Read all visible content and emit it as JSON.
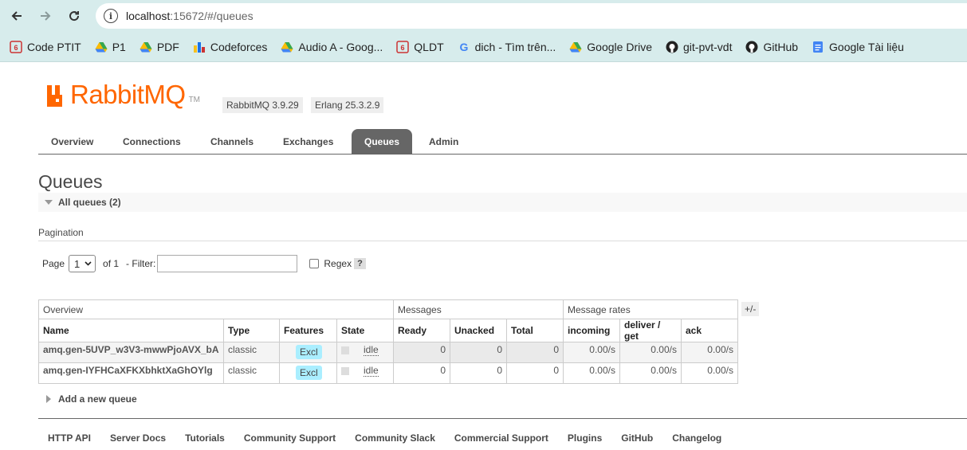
{
  "browser": {
    "url_host": "localhost",
    "url_rest": ":15672/#/queues",
    "bookmarks": [
      {
        "label": "Code PTIT",
        "icon": "ptit-icon",
        "color": "#c33"
      },
      {
        "label": "P1",
        "icon": "drive-icon",
        "color": "#1a73e8"
      },
      {
        "label": "PDF",
        "icon": "drive-icon",
        "color": "#1a73e8"
      },
      {
        "label": "Codeforces",
        "icon": "codeforces-icon",
        "color": "#1a73e8"
      },
      {
        "label": "Audio A - Goog...",
        "icon": "drive-icon",
        "color": "#1a73e8"
      },
      {
        "label": "QLDT",
        "icon": "ptit-icon",
        "color": "#c33"
      },
      {
        "label": "dich - Tìm trên...",
        "icon": "google-icon",
        "color": "#4285f4"
      },
      {
        "label": "Google Drive",
        "icon": "drive-icon",
        "color": "#1a73e8"
      },
      {
        "label": "git-pvt-vdt",
        "icon": "github-icon",
        "color": "#222"
      },
      {
        "label": "GitHub",
        "icon": "github-icon",
        "color": "#222"
      },
      {
        "label": "Google Tài liệu",
        "icon": "docs-icon",
        "color": "#4285f4"
      }
    ]
  },
  "header": {
    "logo_text": "RabbitMQ",
    "logo_tm": "TM",
    "version": "RabbitMQ 3.9.29",
    "erlang": "Erlang 25.3.2.9"
  },
  "tabs": [
    {
      "label": "Overview",
      "active": false
    },
    {
      "label": "Connections",
      "active": false
    },
    {
      "label": "Channels",
      "active": false
    },
    {
      "label": "Exchanges",
      "active": false
    },
    {
      "label": "Queues",
      "active": true
    },
    {
      "label": "Admin",
      "active": false
    }
  ],
  "page_title": "Queues",
  "section_title": "All queues (2)",
  "pagination": {
    "label": "Pagination",
    "page_label": "Page",
    "page_value": "1",
    "of_label": "of 1",
    "filter_label": "- Filter:",
    "filter_value": "",
    "regex_label": "Regex",
    "help": "?"
  },
  "table": {
    "groups": [
      "Overview",
      "Messages",
      "Message rates"
    ],
    "columns": [
      "Name",
      "Type",
      "Features",
      "State",
      "Ready",
      "Unacked",
      "Total",
      "incoming",
      "deliver / get",
      "ack"
    ],
    "toggle": "+/-",
    "rows": [
      {
        "name": "amq.gen-5UVP_w3V3-mwwPjoAVX_bA",
        "type": "classic",
        "features": "Excl",
        "state": "idle",
        "ready": "0",
        "unacked": "0",
        "total": "0",
        "incoming": "0.00/s",
        "deliver": "0.00/s",
        "ack": "0.00/s"
      },
      {
        "name": "amq.gen-IYFHCaXFKXbhktXaGhOYlg",
        "type": "classic",
        "features": "Excl",
        "state": "idle",
        "ready": "0",
        "unacked": "0",
        "total": "0",
        "incoming": "0.00/s",
        "deliver": "0.00/s",
        "ack": "0.00/s"
      }
    ]
  },
  "add_queue": "Add a new queue",
  "footer": [
    "HTTP API",
    "Server Docs",
    "Tutorials",
    "Community Support",
    "Community Slack",
    "Commercial Support",
    "Plugins",
    "GitHub",
    "Changelog"
  ]
}
